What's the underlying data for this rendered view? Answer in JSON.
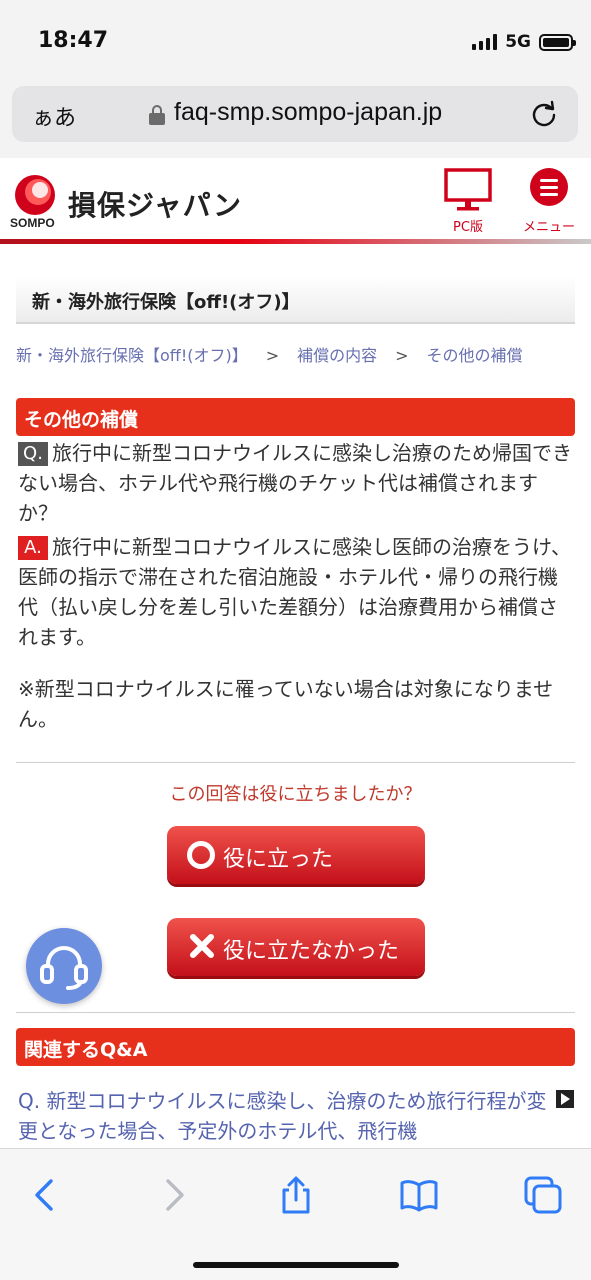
{
  "status": {
    "time": "18:47",
    "network": "5G"
  },
  "browser": {
    "aa_label": "ぁあ",
    "url": "faq-smp.sompo-japan.jp"
  },
  "site": {
    "logo_mark_text": "SOMPO",
    "name": "損保ジャパン",
    "pc_label": "PC版",
    "menu_label": "メニュー",
    "accent_color": "#d0021b"
  },
  "category": {
    "title": "新・海外旅行保険【off!(オフ)】"
  },
  "breadcrumb": {
    "items": [
      "新・海外旅行保険【off!(オフ)】",
      "補償の内容",
      "その他の補償"
    ],
    "separator": ">"
  },
  "section": {
    "title": "その他の補償"
  },
  "faq": {
    "q_tag": "Q.",
    "question": "旅行中に新型コロナウイルスに感染し治療のため帰国できない場合、ホテル代や飛行機のチケット代は補償されますか？",
    "a_tag": "A.",
    "answer": "旅行中に新型コロナウイルスに感染し医師の治療をうけ、医師の指示で滞在された宿泊施設・ホテル代・帰りの飛行機代（払い戻し分を差し引いた差額分）は治療費用から補償されます。",
    "note": "※新型コロナウイルスに罹っていない場合は対象になりません。"
  },
  "feedback": {
    "question": "この回答は役に立ちましたか？",
    "helpful_label": "役に立った",
    "not_helpful_label": "役に立たなかった"
  },
  "related": {
    "title": "関連するQ&A",
    "items": [
      "Q. 新型コロナウイルスに感染し、治療のため旅行行程が変更となった場合、予定外のホテル代、飛行機"
    ]
  },
  "icons": {
    "support": "headset-icon",
    "back": "chevron-left-icon",
    "forward": "chevron-right-icon",
    "share": "share-icon",
    "bookmarks": "book-icon",
    "tabs": "tabs-icon"
  }
}
